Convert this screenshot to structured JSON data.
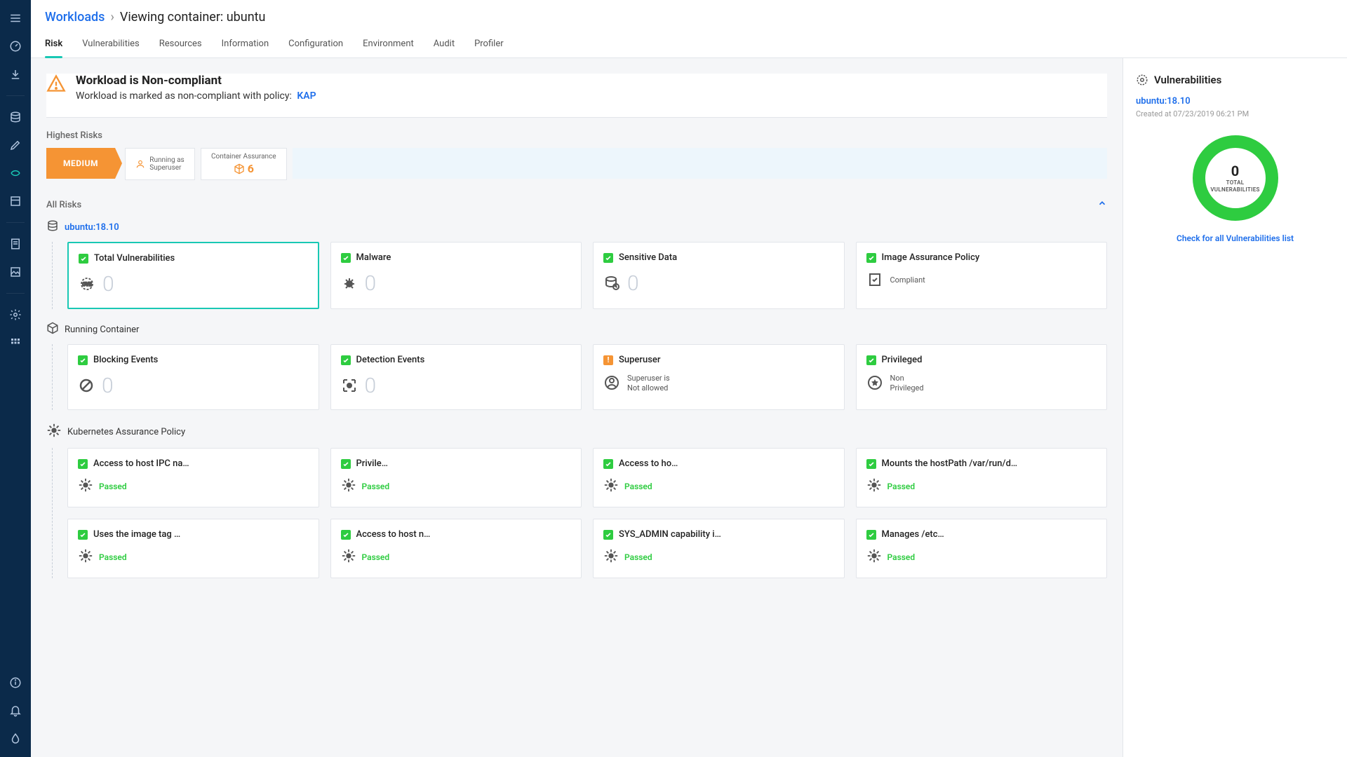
{
  "breadcrumb": {
    "root": "Workloads",
    "current": "Viewing container: ubuntu"
  },
  "tabs": [
    "Risk",
    "Vulnerabilities",
    "Resources",
    "Information",
    "Configuration",
    "Environment",
    "Audit",
    "Profiler"
  ],
  "active_tab": 0,
  "banner": {
    "title": "Workload is Non-compliant",
    "subtitle": "Workload is marked as non-compliant with  policy:",
    "policy_link": "KAP"
  },
  "highest_risks": {
    "label": "Highest Risks",
    "severity": "MEDIUM",
    "item1": {
      "line1": "Running as",
      "line2": "Superuser"
    },
    "item2": {
      "label": "Container Assurance",
      "value": "6"
    }
  },
  "all_risks": {
    "label": "All Risks",
    "groups": [
      {
        "head": "ubuntu:18.10",
        "head_link": true,
        "icon": "stack",
        "cards": [
          {
            "title": "Total Vulnerabilities",
            "status": "ok",
            "kind": "count",
            "value": "0",
            "icon": "cve",
            "selected": true
          },
          {
            "title": "Malware",
            "status": "ok",
            "kind": "count",
            "value": "0",
            "icon": "bug"
          },
          {
            "title": "Sensitive Data",
            "status": "ok",
            "kind": "count",
            "value": "0",
            "icon": "db"
          },
          {
            "title": "Image Assurance Policy",
            "status": "ok",
            "kind": "text",
            "text": "Compliant",
            "icon": "policy"
          }
        ]
      },
      {
        "head": "Running Container",
        "head_link": false,
        "icon": "cube",
        "cards": [
          {
            "title": "Blocking Events",
            "status": "ok",
            "kind": "count",
            "value": "0",
            "icon": "block"
          },
          {
            "title": "Detection Events",
            "status": "ok",
            "kind": "count",
            "value": "0",
            "icon": "detect"
          },
          {
            "title": "Superuser",
            "status": "warn",
            "kind": "text2",
            "line1": "Superuser is",
            "line2": "Not allowed",
            "icon": "user"
          },
          {
            "title": "Privileged",
            "status": "ok",
            "kind": "text2",
            "line1": "Non",
            "line2": "Privileged",
            "icon": "star"
          }
        ]
      },
      {
        "head": "Kubernetes Assurance Policy",
        "head_link": false,
        "icon": "wheel",
        "cards": [
          {
            "title": "Access to host IPC na…",
            "status": "ok",
            "kind": "passed"
          },
          {
            "title": "Privile…",
            "status": "ok",
            "kind": "passed"
          },
          {
            "title": "Access to ho…",
            "status": "ok",
            "kind": "passed"
          },
          {
            "title": "Mounts the hostPath /var/run/d…",
            "status": "ok",
            "kind": "passed"
          },
          {
            "title": "Uses the image tag …",
            "status": "ok",
            "kind": "passed"
          },
          {
            "title": "Access to host n…",
            "status": "ok",
            "kind": "passed"
          },
          {
            "title": "SYS_ADMIN capability i…",
            "status": "ok",
            "kind": "passed"
          },
          {
            "title": "Manages /etc…",
            "status": "ok",
            "kind": "passed"
          }
        ]
      }
    ]
  },
  "passed_label": "Passed",
  "rhs": {
    "title": "Vulnerabilities",
    "image": "ubuntu:18.10",
    "created": "Created at 07/23/2019 06:21 PM",
    "total": "0",
    "total_label1": "TOTAL",
    "total_label2": "VULNERABILITIES",
    "link": "Check for all Vulnerabilities list"
  },
  "sidebar_icons": [
    "menu",
    "dash",
    "down",
    "",
    "stack",
    "pencil",
    "swirl",
    "panel",
    "",
    "doc",
    "image",
    "",
    "gear",
    "grid",
    "",
    "info",
    "bell",
    "drop"
  ]
}
